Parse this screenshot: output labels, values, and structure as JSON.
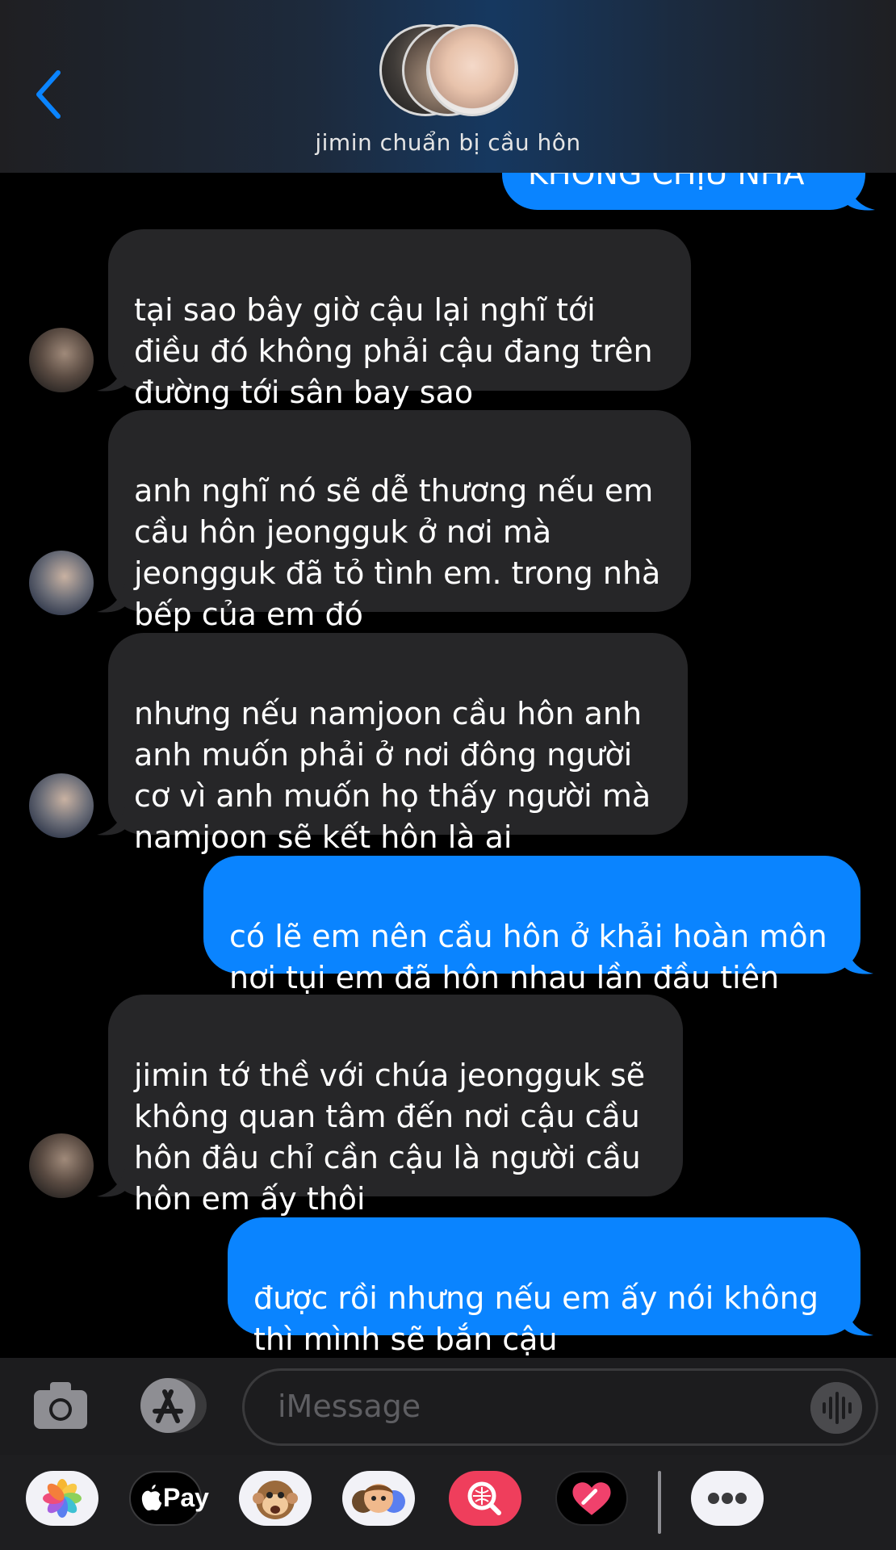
{
  "header": {
    "title": "jimin chuẩn bị cầu hôn"
  },
  "messages": [
    {
      "dir": "out",
      "text": "KHÔNG CHỊU NHA",
      "clipped": true
    },
    {
      "dir": "in",
      "sender": "taehyung-avatar",
      "text": "tại sao bây giờ cậu lại nghĩ tới\nđiều đó không phải cậu đang trên\nđường tới sân bay sao"
    },
    {
      "dir": "in",
      "sender": "seokjin-avatar",
      "text": "anh nghĩ nó sẽ dễ thương nếu em\ncầu hôn jeongguk ở nơi mà\njeongguk đã tỏ tình em. trong nhà\nbếp của em đó"
    },
    {
      "dir": "in",
      "sender": "seokjin-avatar",
      "text": "nhưng nếu namjoon cầu hôn anh\nanh muốn phải ở nơi đông người\ncơ vì anh muốn họ thấy người mà\nnamjoon sẽ kết hôn là ai"
    },
    {
      "dir": "out",
      "text": "có lẽ em nên cầu hôn ở khải hoàn môn\nnơi tụi em đã hôn nhau lần đầu tiên"
    },
    {
      "dir": "in",
      "sender": "taehyung-avatar",
      "text": "jimin tớ thề với chúa jeongguk sẽ\nkhông quan tâm đến nơi cậu cầu\nhôn đâu chỉ cần cậu là người cầu\nhôn em ấy thôi"
    },
    {
      "dir": "out",
      "text": "được rồi nhưng nếu em ấy nói không\nthì mình sẽ bắn cậu"
    }
  ],
  "composer": {
    "placeholder": "iMessage"
  },
  "app_drawer": {
    "items": [
      "photos-icon",
      "apple-pay",
      "animoji-icon",
      "memoji-icon",
      "images-search-icon",
      "digital-touch-icon",
      "more-icon"
    ],
    "apple_pay_label": "Pay"
  },
  "colors": {
    "outgoing": "#0a84ff",
    "incoming": "#262628",
    "back": "#0a84ff"
  }
}
